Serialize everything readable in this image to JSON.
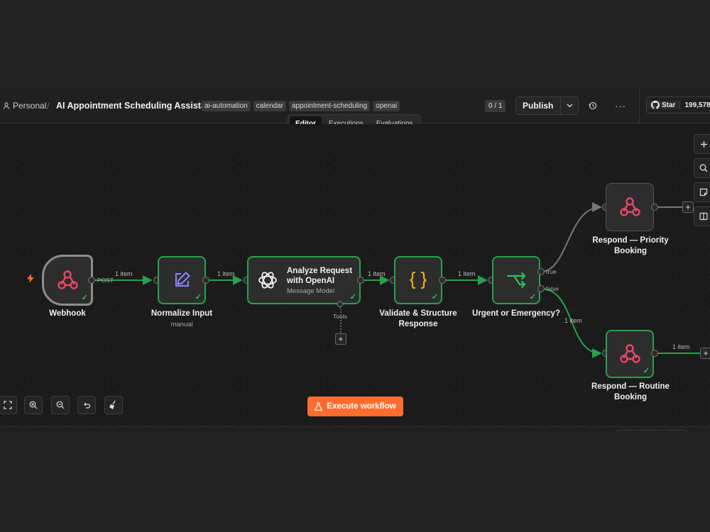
{
  "header": {
    "workspace": "Personal",
    "separator": "/",
    "workflow_title": "AI Appointment Scheduling Assistant",
    "tags": [
      "ai-automation",
      "calendar",
      "appointment-scheduling",
      "openai"
    ],
    "counter": "0 / 1",
    "publish_label": "Publish",
    "more_label": "···",
    "github_star_label": "Star",
    "github_star_count": "199,578"
  },
  "tabs": [
    {
      "label": "Editor",
      "active": true
    },
    {
      "label": "Executions",
      "active": false
    },
    {
      "label": "Evaluations",
      "active": false
    }
  ],
  "nodes": {
    "webhook": {
      "title": "Webhook",
      "port_label": "POST",
      "icon": "webhook-icon"
    },
    "normalize": {
      "title": "Normalize Input",
      "subtitle": "manual",
      "icon": "edit-icon"
    },
    "openai": {
      "title_line1": "Analyze Request",
      "title_line2": "with OpenAI",
      "subtitle": "Message Model",
      "tools_label": "Tools",
      "icon": "openai-icon"
    },
    "validate": {
      "title_line1": "Validate & Structure",
      "title_line2": "Response",
      "icon": "code-braces-icon"
    },
    "urgent": {
      "title": "Urgent or Emergency?",
      "true_label": "true",
      "false_label": "false",
      "icon": "if-branch-icon"
    },
    "priority": {
      "title_line1": "Respond — Priority",
      "title_line2": "Booking",
      "icon": "webhook-icon"
    },
    "routine": {
      "title_line1": "Respond — Routine",
      "title_line2": "Booking",
      "icon": "webhook-icon"
    }
  },
  "edge_labels": {
    "e1": "1 item",
    "e2": "1 item",
    "e3": "1 item",
    "e4": "1 item",
    "e_false": "1 item",
    "e_routine_out": "1 item"
  },
  "execute_button": "Execute workflow",
  "colors": {
    "success_edge": "#26a24d",
    "idle_edge": "#666666",
    "accent_orange": "#ff6d2e",
    "webhook_pink": "#e8466b",
    "edit_purple": "#8b7cf6",
    "code_orange": "#f5a623",
    "branch_green": "#2fbf5f"
  }
}
